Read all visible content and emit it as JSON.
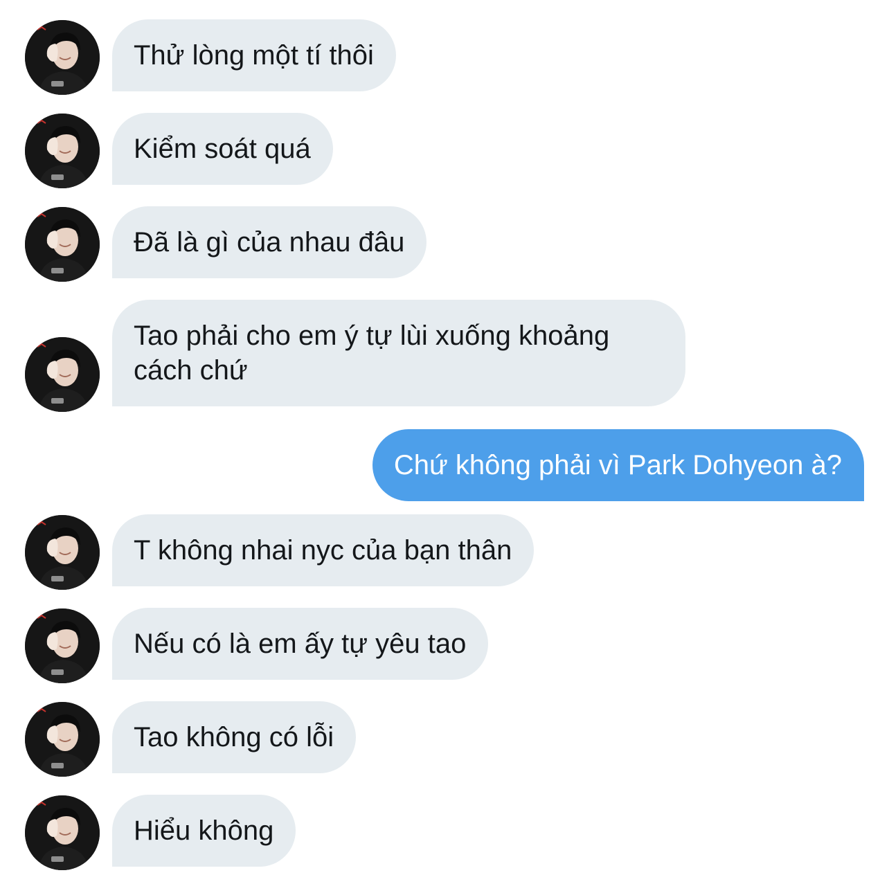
{
  "conversation": {
    "avatar_icon": "profile-photo-avatar",
    "incoming_bubble_color": "#e6ecf0",
    "outgoing_bubble_color": "#4d9fea",
    "messages": [
      {
        "direction": "in",
        "text": "Thử lòng một tí thôi"
      },
      {
        "direction": "in",
        "text": "Kiểm soát quá"
      },
      {
        "direction": "in",
        "text": "Đã là gì của nhau đâu"
      },
      {
        "direction": "in",
        "text": "Tao phải cho em ý tự lùi xuống khoảng cách chứ"
      },
      {
        "direction": "out",
        "text": "Chứ không phải vì Park Dohyeon à?"
      },
      {
        "direction": "in",
        "text": "T không nhai nyc của bạn thân"
      },
      {
        "direction": "in",
        "text": "Nếu có là em ấy tự yêu tao"
      },
      {
        "direction": "in",
        "text": "Tao không có lỗi"
      },
      {
        "direction": "in",
        "text": "Hiểu không"
      }
    ]
  }
}
